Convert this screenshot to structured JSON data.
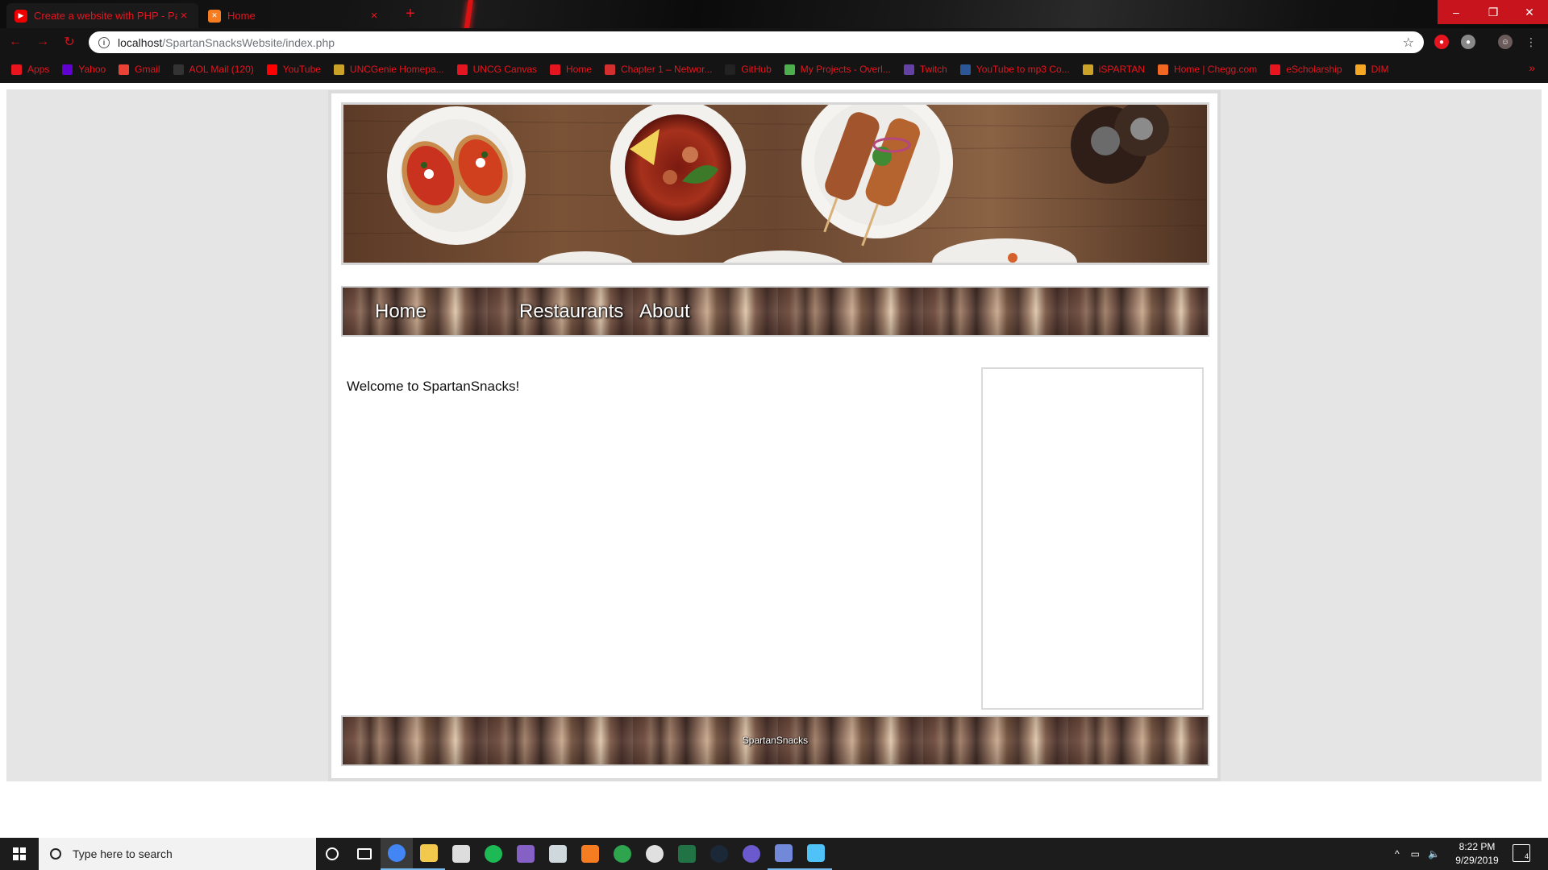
{
  "browser": {
    "tabs": [
      {
        "title": "Create a website with PHP - Par",
        "favicon": "youtube-icon",
        "active": true
      },
      {
        "title": "Home",
        "favicon": "xampp-icon",
        "active": false
      }
    ],
    "new_tab": "+",
    "window_controls": {
      "minimize": "–",
      "maximize": "❐",
      "close": "✕"
    },
    "address": {
      "host": "localhost",
      "path": "/SpartanSnacksWebsite/index.php"
    },
    "bookmarks": [
      {
        "label": "Apps",
        "icon": "apps-grid-icon",
        "color": "#e8141e"
      },
      {
        "label": "Yahoo",
        "icon": "yahoo-icon",
        "color": "#6001d2"
      },
      {
        "label": "Gmail",
        "icon": "gmail-icon",
        "color": "#ea4335"
      },
      {
        "label": "AOL Mail (120)",
        "icon": "aol-icon",
        "color": "#333333"
      },
      {
        "label": "YouTube",
        "icon": "youtube-icon",
        "color": "#ff0000"
      },
      {
        "label": "UNCGenie Homepa...",
        "icon": "uncg-icon",
        "color": "#c9a227"
      },
      {
        "label": "UNCG Canvas",
        "icon": "canvas-icon",
        "color": "#e4151e"
      },
      {
        "label": "Home",
        "icon": "spartan-icon",
        "color": "#e4151e"
      },
      {
        "label": "Chapter 1 – Networ...",
        "icon": "chapter-icon",
        "color": "#d32f2f"
      },
      {
        "label": "GitHub",
        "icon": "github-icon",
        "color": "#222222"
      },
      {
        "label": "My Projects - Overl...",
        "icon": "overleaf-icon",
        "color": "#4cae4c"
      },
      {
        "label": "Twitch",
        "icon": "twitch-icon",
        "color": "#6441a5"
      },
      {
        "label": "YouTube to mp3 Co...",
        "icon": "mp3-icon",
        "color": "#2b5797"
      },
      {
        "label": "iSPARTAN",
        "icon": "uncg-icon",
        "color": "#c9a227"
      },
      {
        "label": "Home | Chegg.com",
        "icon": "chegg-icon",
        "color": "#f26722"
      },
      {
        "label": "eScholarship",
        "icon": "escholarship-icon",
        "color": "#e8141e"
      },
      {
        "label": "DIM",
        "icon": "dim-icon",
        "color": "#f5a623"
      }
    ],
    "bookmarks_more": "»"
  },
  "site": {
    "nav": [
      {
        "label": "Home"
      },
      {
        "label": "Restaurants"
      },
      {
        "label": "About"
      }
    ],
    "welcome_text": "Welcome to SpartanSnacks!",
    "footer_text": "SpartanSnacks",
    "banner_alt": "food-dishes-banner"
  },
  "taskbar": {
    "search_placeholder": "Type here to search",
    "apps": [
      "cortana-icon",
      "task-view-icon",
      "chrome-icon",
      "file-explorer-icon",
      "photos-icon",
      "spotify-icon",
      "visual-studio-icon",
      "mail-icon",
      "xampp-icon",
      "gitkraken-icon",
      "xbox-icon",
      "excel-icon",
      "steam-icon",
      "tidal-icon",
      "discord-icon",
      "cube-icon"
    ],
    "clock_time": "8:22 PM",
    "clock_date": "9/29/2019",
    "notification_count": "4"
  }
}
